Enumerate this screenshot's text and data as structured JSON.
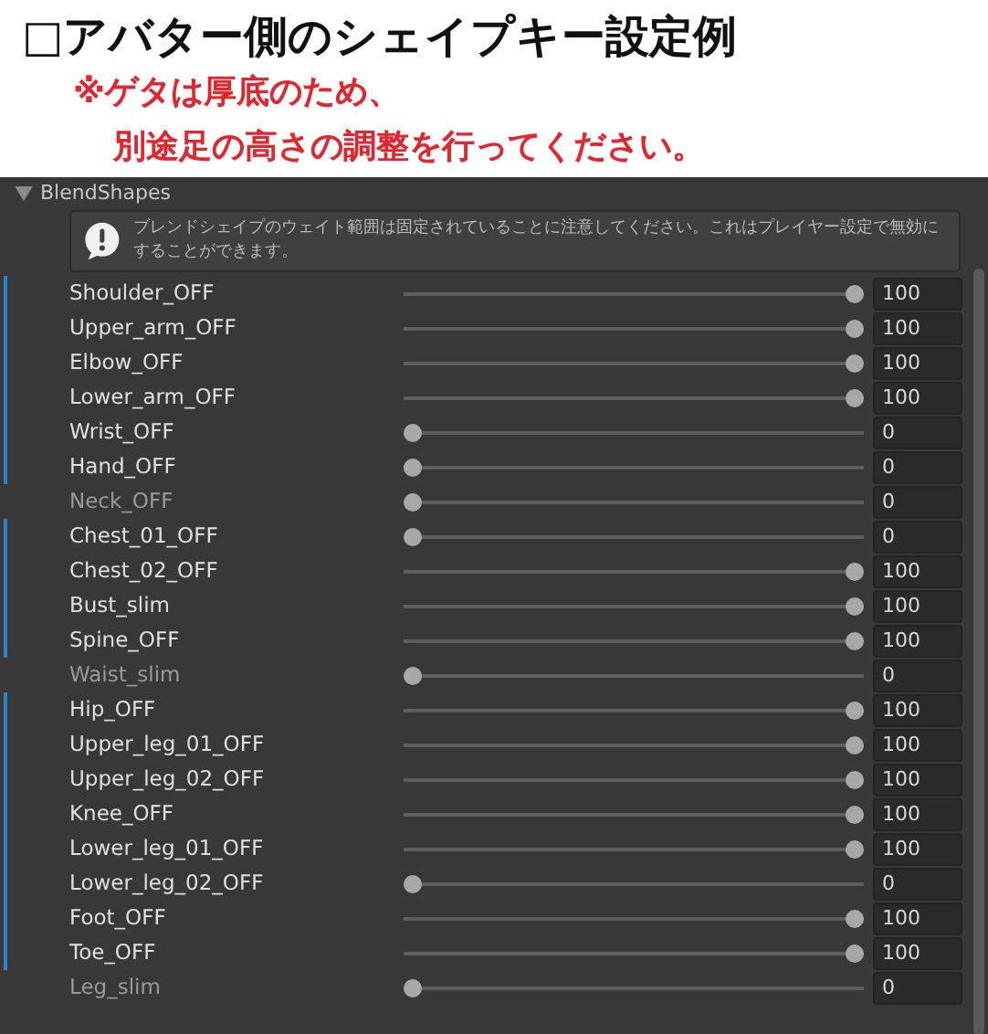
{
  "title": "□アバター側のシェイプキー設定例",
  "notes": [
    "※ゲタは厚底のため、",
    "別途足の高さの調整を行ってください。"
  ],
  "foldout": {
    "label": "BlendShapes",
    "expanded": true
  },
  "help": {
    "text": "ブレンドシェイプのウェイト範囲は固定されていることに注意してください。これはプレイヤー設定で無効にすることができます。"
  },
  "rows": [
    {
      "name": "Shoulder_OFF",
      "overridden": true,
      "level": 1,
      "value": "100"
    },
    {
      "name": "Upper_arm_OFF",
      "overridden": true,
      "level": 1,
      "value": "100"
    },
    {
      "name": "Elbow_OFF",
      "overridden": true,
      "level": 1,
      "value": "100"
    },
    {
      "name": "Lower_arm_OFF",
      "overridden": true,
      "level": 1,
      "value": "100"
    },
    {
      "name": "Wrist_OFF",
      "overridden": true,
      "level": 0,
      "value": "0"
    },
    {
      "name": "Hand_OFF",
      "overridden": true,
      "level": 0,
      "value": "0"
    },
    {
      "name": "Neck_OFF",
      "overridden": false,
      "level": 0,
      "value": "0"
    },
    {
      "name": "Chest_01_OFF",
      "overridden": true,
      "level": 0,
      "value": "0"
    },
    {
      "name": "Chest_02_OFF",
      "overridden": true,
      "level": 1,
      "value": "100"
    },
    {
      "name": "Bust_slim",
      "overridden": true,
      "level": 1,
      "value": "100"
    },
    {
      "name": "Spine_OFF",
      "overridden": true,
      "level": 1,
      "value": "100"
    },
    {
      "name": "Waist_slim",
      "overridden": false,
      "level": 0,
      "value": "0"
    },
    {
      "name": "Hip_OFF",
      "overridden": true,
      "level": 1,
      "value": "100"
    },
    {
      "name": "Upper_leg_01_OFF",
      "overridden": true,
      "level": 1,
      "value": "100"
    },
    {
      "name": "Upper_leg_02_OFF",
      "overridden": true,
      "level": 1,
      "value": "100"
    },
    {
      "name": "Knee_OFF",
      "overridden": true,
      "level": 1,
      "value": "100"
    },
    {
      "name": "Lower_leg_01_OFF",
      "overridden": true,
      "level": 1,
      "value": "100"
    },
    {
      "name": "Lower_leg_02_OFF",
      "overridden": true,
      "level": 0,
      "value": "0"
    },
    {
      "name": "Foot_OFF",
      "overridden": true,
      "level": 1,
      "value": "100"
    },
    {
      "name": "Toe_OFF",
      "overridden": true,
      "level": 1,
      "value": "100"
    },
    {
      "name": "Leg_slim",
      "overridden": false,
      "level": 0,
      "value": "0"
    }
  ]
}
